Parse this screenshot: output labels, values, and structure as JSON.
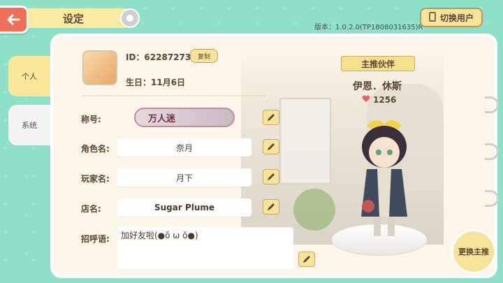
{
  "header": {
    "title": "设定",
    "version": "版本：1.0.2.0(TP1808031635)R",
    "switch_user": "切换用户"
  },
  "tabs": {
    "personal": "个人",
    "system": "系统"
  },
  "profile": {
    "id_text": "ID：62287273",
    "copy_label": "复制",
    "birthday_text": "生日：11月6日"
  },
  "form": {
    "title_label": "称号:",
    "title_value": "万人迷",
    "role_label": "角色名:",
    "role_value": "奈月",
    "player_label": "玩家名:",
    "player_value": "月下",
    "store_label": "店名:",
    "store_value": "Sugar Plume",
    "greeting_label": "招呼语:",
    "greeting_value": "加好友啦(●ŏ ω ŏ●)"
  },
  "partner": {
    "banner": "主推伙伴",
    "name": "伊恩．休斯",
    "affection": "1256",
    "change_button": "更换主推"
  },
  "colors": {
    "accent_yellow": "#f8e39a",
    "back_red": "#f07158",
    "mint_bg": "#8fe0c9"
  }
}
